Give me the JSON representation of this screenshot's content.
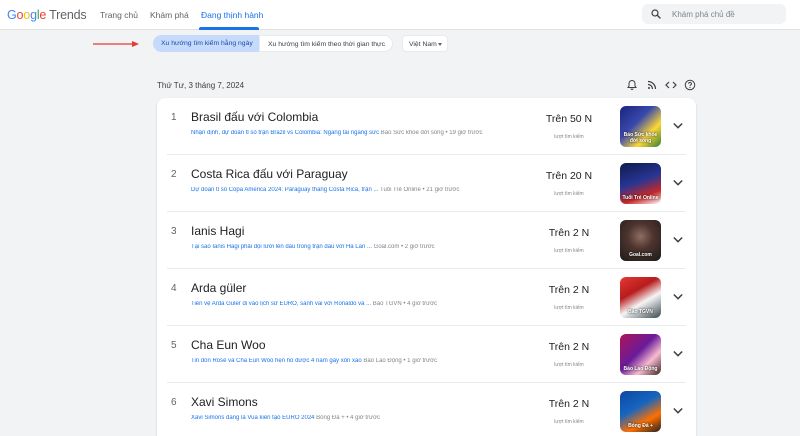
{
  "header": {
    "logo": {
      "google": "Google",
      "trends": "Trends"
    },
    "nav": [
      "Trang chủ",
      "Khám phá",
      "Đang thịnh hành"
    ],
    "search_placeholder": "Khám phá chủ đề"
  },
  "filters": {
    "daily": "Xu hướng tìm kiếm hằng ngày",
    "realtime": "Xu hướng tìm kiếm theo thời gian thực",
    "country": "Việt Nam"
  },
  "date": "Thứ Tư, 3 tháng 7, 2024",
  "volume_label": "lượt tìm kiếm",
  "trends": [
    {
      "rank": "1",
      "title": "Brasil đấu với Colombia",
      "snippet": "Nhận định, dự đoán tỉ số trận Brazil vs Colombia: Ngang tài ngang sức",
      "source": " Báo Sức khỏe đời sống • 19 giờ trước",
      "volume": "Trên 50 N",
      "thumb_caption": "Báo Sức khỏe đời sống"
    },
    {
      "rank": "2",
      "title": "Costa Rica đấu với Paraguay",
      "snippet": "Dự đoán tỉ số Copa America 2024: Paraguay thắng Costa Rica, trận ...",
      "source": " Tuổi Trẻ Online • 21 giờ trước",
      "volume": "Trên 20 N",
      "thumb_caption": "Tuổi Trẻ Online"
    },
    {
      "rank": "3",
      "title": "Ianis Hagi",
      "snippet": "Tại sao Ianis Hagi phải đội lưới lên đầu trong trận đấu với Hà Lan ...",
      "source": " Goal.com • 2 giờ trước",
      "volume": "Trên 2 N",
      "thumb_caption": "Goal.com"
    },
    {
      "rank": "4",
      "title": "Arda güler",
      "snippet": "Tiền vệ Arda Guler đi vào lịch sử EURO, sánh vai với Ronaldo và ...",
      "source": " Báo TGVN • 4 giờ trước",
      "volume": "Trên 2 N",
      "thumb_caption": "Báo TGVN"
    },
    {
      "rank": "5",
      "title": "Cha Eun Woo",
      "snippet": "Tin đồn Rosé và Cha Eun Woo hẹn hò được 4 năm gây xôn xao",
      "source": " Báo Lao Động • 1 giờ trước",
      "volume": "Trên 2 N",
      "thumb_caption": "Báo Lao Động"
    },
    {
      "rank": "6",
      "title": "Xavi Simons",
      "snippet": "Xavi Simons đang là Vua kiến tạo EURO 2024",
      "source": " Bóng Đá + • 4 giờ trước",
      "volume": "Trên 2 N",
      "thumb_caption": "Bóng Đá +"
    }
  ]
}
